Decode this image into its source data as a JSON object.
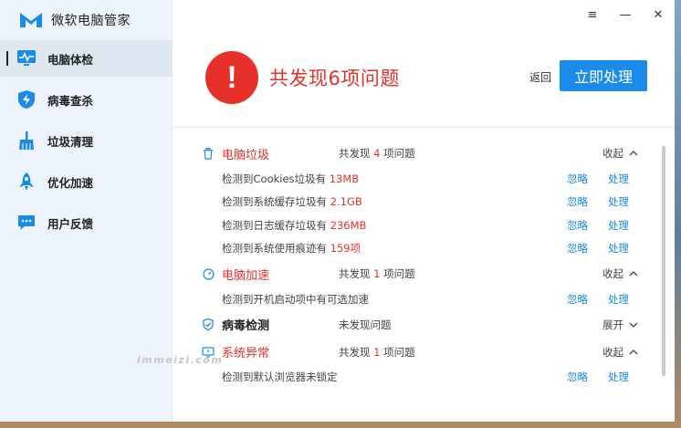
{
  "app": {
    "title": "微软电脑管家"
  },
  "sidebar": {
    "items": [
      {
        "label": "电脑体检",
        "icon": "monitor-pulse-icon",
        "active": true
      },
      {
        "label": "病毒查杀",
        "icon": "shield-bolt-icon",
        "active": false
      },
      {
        "label": "垃圾清理",
        "icon": "broom-icon",
        "active": false
      },
      {
        "label": "优化加速",
        "icon": "rocket-icon",
        "active": false
      },
      {
        "label": "用户反馈",
        "icon": "chat-bubble-icon",
        "active": false
      }
    ]
  },
  "window_controls": {
    "menu": "≡",
    "minimize": "—",
    "close": "✕"
  },
  "header": {
    "alert_symbol": "!",
    "headline": "共发现6项问题",
    "back_label": "返回",
    "primary_label": "立即处理"
  },
  "sections": [
    {
      "title": "电脑垃圾",
      "summary_prefix": "共发现",
      "summary_count": "4",
      "summary_suffix": "项问题",
      "toggle": "收起",
      "rows": [
        {
          "text": "检测到Cookies垃圾有",
          "highlight": "13MB"
        },
        {
          "text": "检测到系统缓存垃圾有",
          "highlight": "2.1GB"
        },
        {
          "text": "检测到日志缓存垃圾有",
          "highlight": "236MB"
        },
        {
          "text": "检测到系统使用痕迹有",
          "highlight": "159项"
        }
      ]
    },
    {
      "title": "电脑加速",
      "summary_prefix": "共发现",
      "summary_count": "1",
      "summary_suffix": "项问题",
      "toggle": "收起",
      "rows": [
        {
          "text": "检测到开机启动项中有可选加速",
          "highlight": ""
        }
      ]
    },
    {
      "title": "病毒检测",
      "summary_text": "未发现问题",
      "toggle": "展开",
      "rows": []
    },
    {
      "title": "系统异常",
      "summary_prefix": "共发现",
      "summary_count": "1",
      "summary_suffix": "项问题",
      "toggle": "收起",
      "rows": [
        {
          "text": "检测到默认浏览器未锁定",
          "highlight": ""
        }
      ]
    }
  ],
  "actions": {
    "ignore": "忽略",
    "handle": "处理"
  },
  "watermark": "lmmeizi.com",
  "colors": {
    "accent": "#1a8be8",
    "alert": "#e8302a",
    "sidebar_bg": "#eef4fb"
  }
}
